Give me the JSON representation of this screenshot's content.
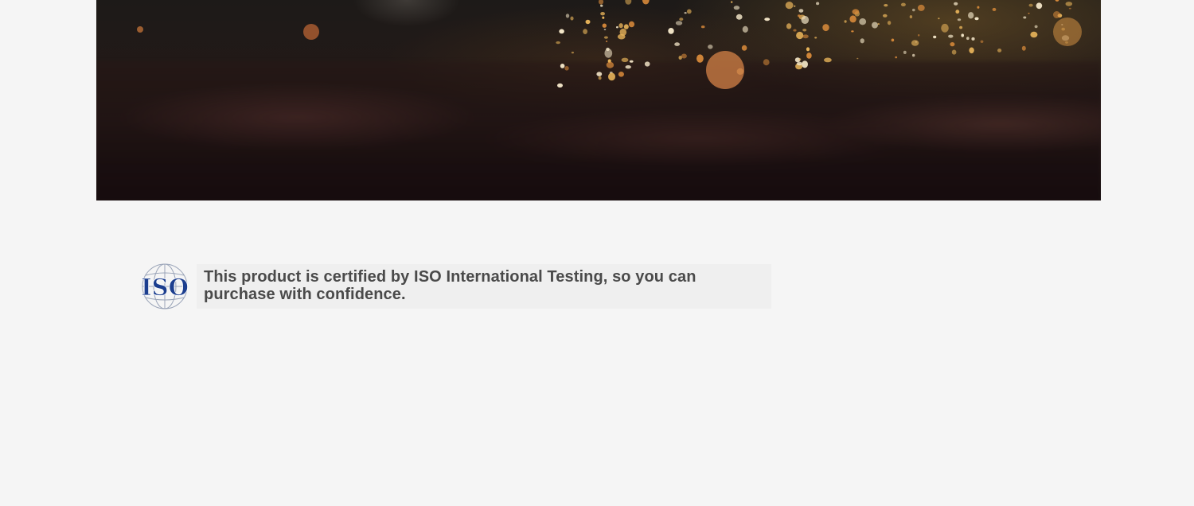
{
  "hero": {
    "image_icon": "welding-sparks-image"
  },
  "certification": {
    "logo_icon": "iso-logo-icon",
    "logo_text": "ISO",
    "text": "This product is certified by ISO International Testing, so you can purchase with confidence."
  },
  "colors": {
    "background": "#f5f5f5",
    "text": "#4a4a4a",
    "iso_blue": "#1d3f8f"
  }
}
